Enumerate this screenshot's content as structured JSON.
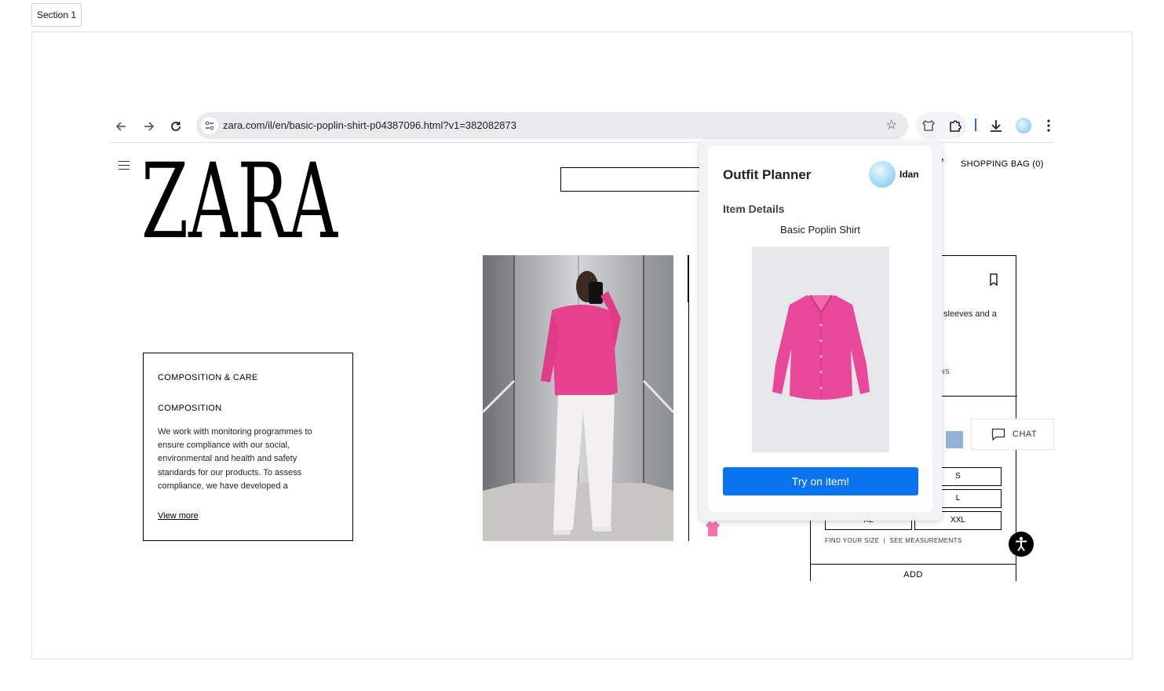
{
  "section": {
    "label": "Section 1"
  },
  "browser": {
    "url": "zara.com/il/en/basic-poplin-shirt-p04387096.html?v1=382082873"
  },
  "zara": {
    "logo_text": "ZARA",
    "cart_fragment": "?",
    "shopping_bag": "SHOPPING BAG (0)",
    "composition_care": {
      "title": "COMPOSITION & CARE",
      "subtitle": "COMPOSITION",
      "text": "We work with monitoring programmes to ensure compliance with our social, environmental and health and safety standards for our products. To assess compliance, we have developed a",
      "link": "View more"
    },
    "product": {
      "description_fragment": "sleeves and a",
      "label_fragment": "NS",
      "swatch_color": "#93b3d6",
      "sizes": [
        "S",
        "L",
        "XL",
        "XXL"
      ],
      "find_your_size": "FIND YOUR SIZE",
      "separator": "|",
      "see_measurements": "SEE MEASUREMENTS",
      "add": "ADD"
    },
    "chat": {
      "label": "CHAT"
    }
  },
  "extension": {
    "title": "Outfit Planner",
    "user_name": "Idan",
    "section_heading": "Item Details",
    "item_name": "Basic Poplin Shirt",
    "button_label": "Try on item!",
    "button_color": "#0a73f0"
  }
}
